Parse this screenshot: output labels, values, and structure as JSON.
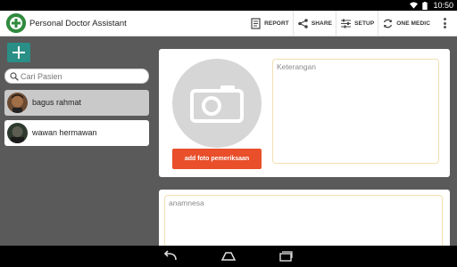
{
  "status_bar": {
    "time": "10:50",
    "icons": [
      "wifi-icon",
      "battery-icon"
    ]
  },
  "action_bar": {
    "title": "Personal Doctor Assistant",
    "actions": [
      {
        "label": "REPORT",
        "icon": "report-icon"
      },
      {
        "label": "SHARE",
        "icon": "share-icon"
      },
      {
        "label": "SETUP",
        "icon": "setup-icon"
      },
      {
        "label": "ONE MEDIC",
        "icon": "sync-icon"
      }
    ],
    "overflow_icon": "more-vert-icon"
  },
  "sidebar": {
    "search_placeholder": "Cari Pasien",
    "patients": [
      {
        "name": "bagus rahmat",
        "selected": true
      },
      {
        "name": "wawan  hermawan",
        "selected": false
      }
    ]
  },
  "main": {
    "photo_button_label": "add foto pemeriksaan",
    "keterangan_placeholder": "Keterangan",
    "anamnesa_placeholder": "anamnesa"
  },
  "colors": {
    "accent_teal": "#2a8f86",
    "button_red": "#e84f2a",
    "content_bg": "#5a5a5a",
    "note_border": "#f1dfb1"
  }
}
